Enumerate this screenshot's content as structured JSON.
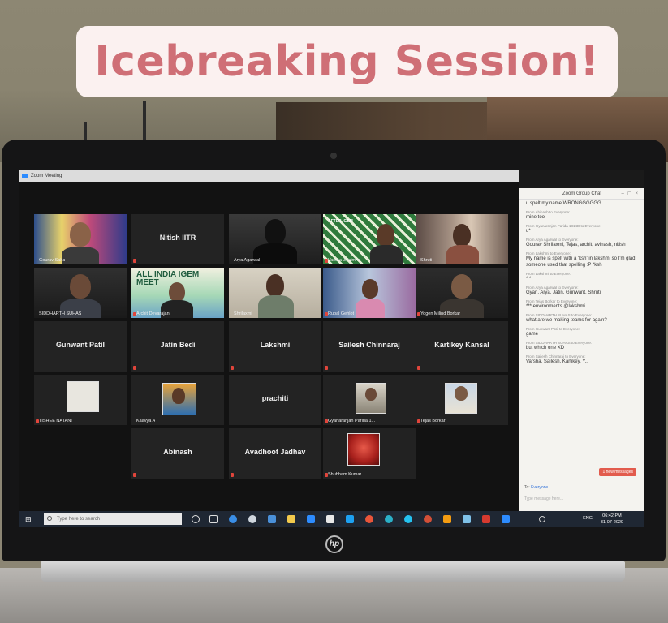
{
  "caption": "Icebreaking Session!",
  "zoom_window_title": "Zoom Meeting",
  "participants": {
    "gourav": "Gourav Saha",
    "nitish": "Nitish IITR",
    "arya": "Arya Agarwal",
    "varsha": "Varsha Jaisimha",
    "shruti": "Shruti",
    "siddharth": "SIDDHARTH SUHAS",
    "archit": "Archit Devarajan",
    "shrilaxmi": "Shrilaxmi",
    "rupal": "Rupal Gehlot",
    "yogen": "Yogen Milind Borkar",
    "gunwant": "Gunwant Patil",
    "jatin": "Jatin Bedi",
    "lakshmi": "Lakshmi",
    "sailesh": "Sailesh Chinnaraj",
    "kartikey": "Kartikey Kansal",
    "tishee": "TISHEE NATANI",
    "kaavya": "Kaavya A",
    "prachiti": "prachiti",
    "gyanaranjan": "Gyanaranjan Parida 1...",
    "tejas": "Tejas Borkar",
    "abinash": "Abinash",
    "avadhoot": "Avadhoot Jadhav",
    "shubham": "Shubham Kumar"
  },
  "tile_images": {
    "archit_banner": "ALL INDIA IGEM MEET",
    "varsha_banner": "AFTER IGEM"
  },
  "chat": {
    "title": "Zoom Group Chat",
    "messages": [
      {
        "from": "",
        "text": "u spelt my name WRONGGGGGG"
      },
      {
        "from": "From Abinash to Everyone:",
        "text": "mine too"
      },
      {
        "from": "From Gyanaranjan Parida 1814D to Everyone:",
        "text": "u*"
      },
      {
        "from": "From Arya Agarwal to Everyone:",
        "text": "Gourav Shrilaxmi, Tejas, archit, avinash, nitish"
      },
      {
        "from": "From Lakshmi to Everyone:",
        "text": "My name is spelt with a 'ksh' in lakshmi so I'm glad someone used that spelling :P *ksh"
      },
      {
        "from": "From Lakshmi to Everyone:",
        "text": "* *"
      },
      {
        "from": "From Arya Agarwal to Everyone:",
        "text": "Gyan, Arya, Jatin, Gunwant, Shruti"
      },
      {
        "from": "From Tejas Borkar to Everyone:",
        "text": "*** environments @lakshmi"
      },
      {
        "from": "From SIDDHARTH SUHAS to Everyone:",
        "text": "what are we making teams for again?"
      },
      {
        "from": "From Gunwant Patil to Everyone:",
        "text": "game"
      },
      {
        "from": "From SIDDHARTH SUHAS to Everyone:",
        "text": "but which one XD"
      },
      {
        "from": "From Sailesh Chinnaraj to Everyone:",
        "text": "Varsha, Sailesh, Kartikey, Y..."
      }
    ],
    "new_messages": "1 new messages",
    "to_label": "To:",
    "to_value": "Everyone",
    "input_placeholder": "Type message here..."
  },
  "taskbar": {
    "search_placeholder": "Type here to search",
    "language": "ENG",
    "time": "06:42 PM",
    "date": "31-07-2020"
  },
  "laptop_brand": "hp",
  "colors": {
    "caption_text": "#cf6f76",
    "caption_bg": "#fbf1f0",
    "zoom_blue": "#2d8cff",
    "active_speaker": "#e8c95a",
    "taskbar": "#1f2733"
  }
}
